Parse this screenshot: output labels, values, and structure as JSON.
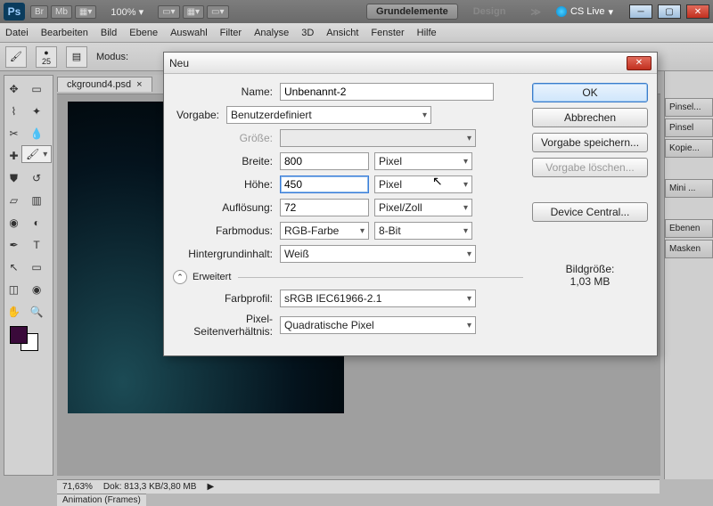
{
  "titlebar": {
    "ps": "Ps",
    "btns": [
      "Br",
      "Mb"
    ],
    "zoom": "100%",
    "tab_essentials": "Grundelemente",
    "tab_design": "Design",
    "cslive": "CS Live"
  },
  "menu": [
    "Datei",
    "Bearbeiten",
    "Bild",
    "Ebene",
    "Auswahl",
    "Filter",
    "Analyse",
    "3D",
    "Ansicht",
    "Fenster",
    "Hilfe"
  ],
  "options": {
    "brush_size": "25",
    "mode_label": "Modus:"
  },
  "doc_tab": "ckground4.psd",
  "right_panels": [
    "Pinsel...",
    "Pinsel",
    "Kopie...",
    "Mini ...",
    "Ebenen",
    "Masken"
  ],
  "status": {
    "zoom": "71,63%",
    "docinfo_label": "Dok:",
    "docinfo": "813,3 KB/3,80 MB"
  },
  "anim_tab": "Animation (Frames)",
  "dialog": {
    "title": "Neu",
    "labels": {
      "name": "Name:",
      "preset": "Vorgabe:",
      "size": "Größe:",
      "width": "Breite:",
      "height": "Höhe:",
      "resolution": "Auflösung:",
      "colormode": "Farbmodus:",
      "bgcontent": "Hintergrundinhalt:",
      "advanced": "Erweitert",
      "colorprofile": "Farbprofil:",
      "pixelratio": "Pixel-Seitenverhältnis:",
      "imagesize": "Bildgröße:"
    },
    "values": {
      "name": "Unbenannt-2",
      "preset": "Benutzerdefiniert",
      "width": "800",
      "width_unit": "Pixel",
      "height": "450",
      "height_unit": "Pixel",
      "resolution": "72",
      "resolution_unit": "Pixel/Zoll",
      "colormode": "RGB-Farbe",
      "bitdepth": "8-Bit",
      "bgcontent": "Weiß",
      "colorprofile": "sRGB IEC61966-2.1",
      "pixelratio": "Quadratische Pixel",
      "imagesize": "1,03 MB"
    },
    "buttons": {
      "ok": "OK",
      "cancel": "Abbrechen",
      "save_preset": "Vorgabe speichern...",
      "delete_preset": "Vorgabe löschen...",
      "device_central": "Device Central..."
    }
  }
}
